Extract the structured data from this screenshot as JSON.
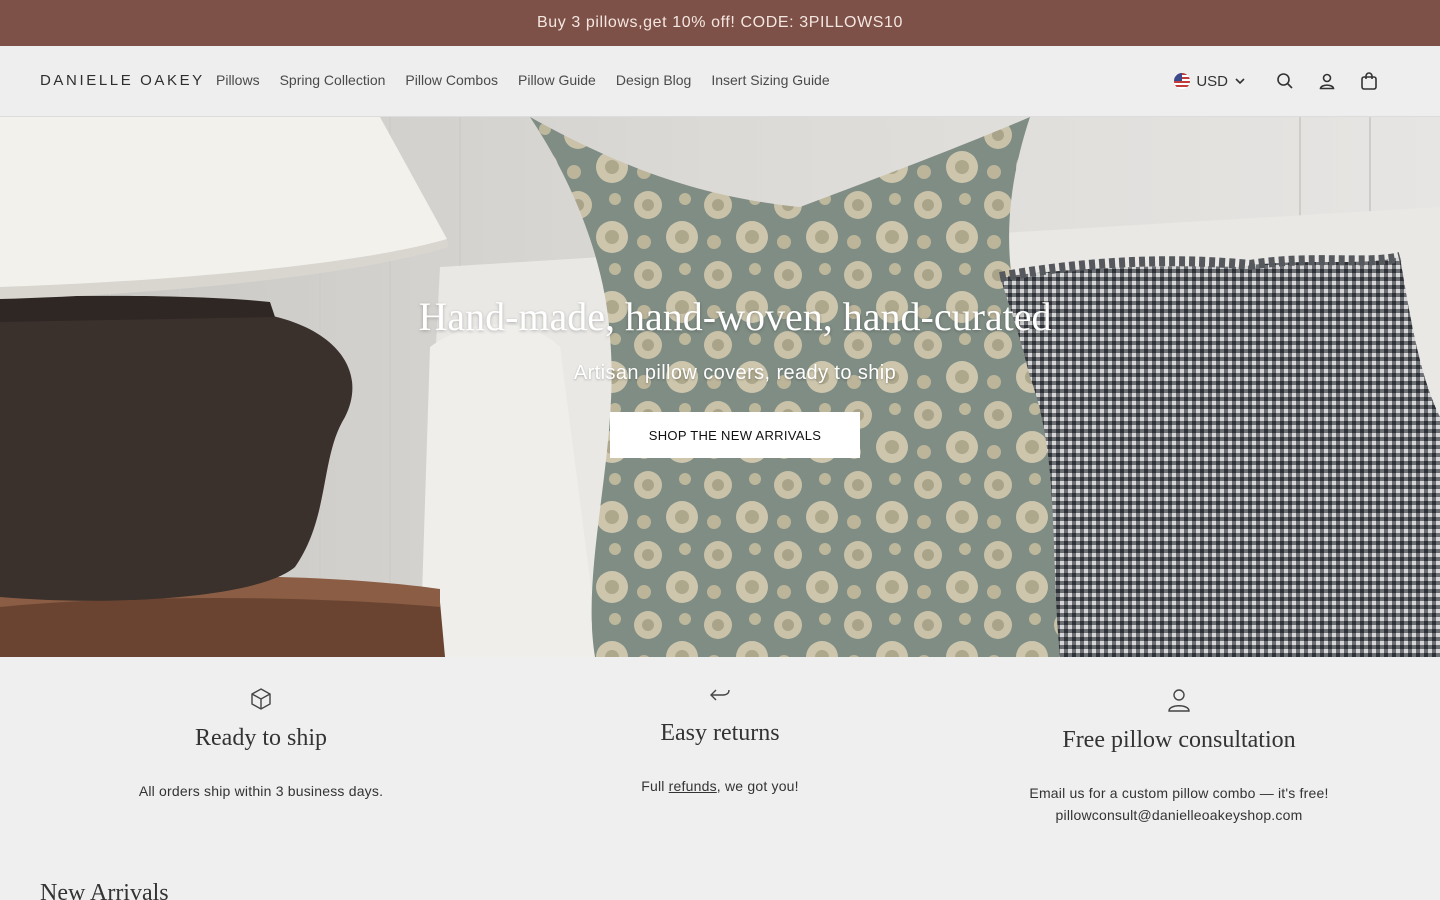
{
  "announcement": {
    "text": "Buy 3 pillows,get 10% off! CODE: 3PILLOWS10"
  },
  "header": {
    "logo": "DANIELLE OAKEY",
    "nav": [
      "Pillows",
      "Spring Collection",
      "Pillow Combos",
      "Pillow Guide",
      "Design Blog",
      "Insert Sizing Guide"
    ],
    "currency": "USD"
  },
  "hero": {
    "title": "Hand-made, hand-woven, hand-curated",
    "subtitle": "Artisan pillow covers, ready to ship",
    "cta": "SHOP THE NEW ARRIVALS"
  },
  "features": [
    {
      "icon": "box-icon",
      "title": "Ready to ship",
      "text": "All orders ship within 3 business days."
    },
    {
      "icon": "return-arrow-icon",
      "title": "Easy returns",
      "text_before": "Full ",
      "link": "refunds",
      "text_after": ", we got you!"
    },
    {
      "icon": "person-icon",
      "title": "Free pillow consultation",
      "line1": "Email us for a custom pillow combo — it's free!",
      "line2": "pillowconsult@danielleoakeyshop.com"
    }
  ],
  "section": {
    "new_arrivals_title": "New Arrivals"
  },
  "colors": {
    "announcement_bg": "#7d5147",
    "page_bg": "#efefef",
    "cta_bg": "#ffffff"
  }
}
